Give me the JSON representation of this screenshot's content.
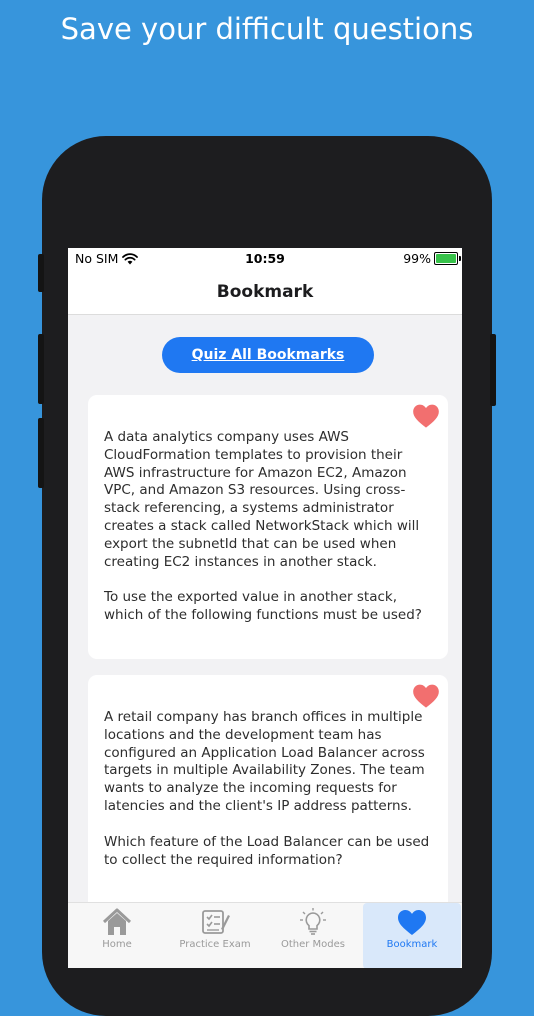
{
  "promo_title": "Save your difficult questions",
  "status": {
    "carrier": "No SIM",
    "time": "10:59",
    "battery": "99%"
  },
  "navbar": {
    "title": "Bookmark"
  },
  "quiz_button": {
    "label": "Quiz All Bookmarks"
  },
  "cards": [
    {
      "question": "A data analytics company uses AWS CloudFormation templates to provision their AWS infrastructure for Amazon EC2, Amazon VPC, and Amazon S3 resources. Using cross-stack referencing, a systems administrator creates a stack called NetworkStack which will export the subnetId that can be used when creating EC2 instances in another stack.",
      "prompt": "To use the exported value in another stack, which of the following functions must be used?"
    },
    {
      "question": "A retail company has branch offices in multiple locations and the development team has configured an Application Load Balancer across targets in multiple Availability Zones. The team wants to analyze the incoming requests for latencies and the client's IP address patterns.",
      "prompt": "Which feature of the Load Balancer can be used to collect the required information?"
    }
  ],
  "tabs": [
    {
      "label": "Home",
      "icon": "home-icon"
    },
    {
      "label": "Practice Exam",
      "icon": "exam-icon"
    },
    {
      "label": "Other Modes",
      "icon": "lightbulb-icon"
    },
    {
      "label": "Bookmark",
      "icon": "heart-icon",
      "active": true
    }
  ],
  "colors": {
    "background": "#3795dc",
    "accent": "#1f78f2",
    "heart": "#f26f6f",
    "battery": "#37c24a"
  }
}
